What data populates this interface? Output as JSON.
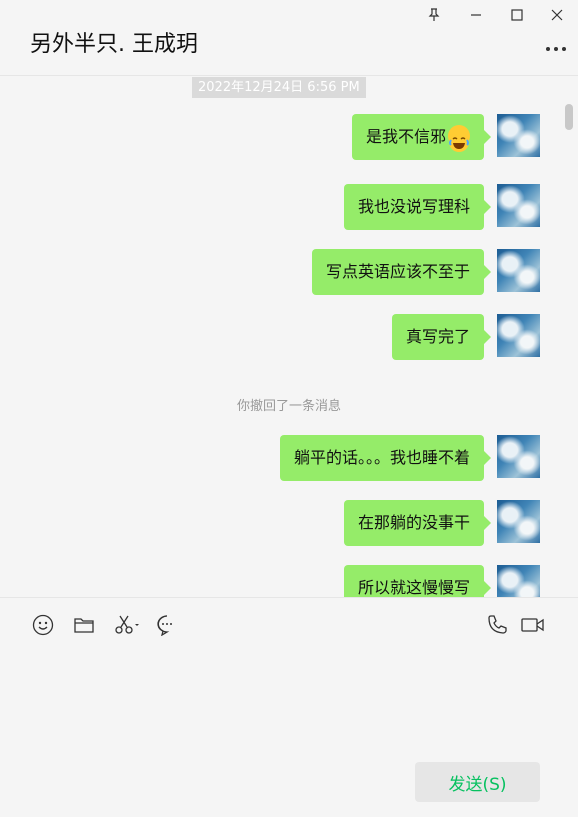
{
  "header": {
    "title": "另外半只. 王成玥"
  },
  "window_controls": [
    "pin-icon",
    "minimize-icon",
    "maximize-icon",
    "close-icon"
  ],
  "chat": {
    "timestamp": "2022年12月24日 6:56 PM",
    "messages": [
      {
        "text": "是我不信邪",
        "emoji": "laughing-tears-emoji"
      },
      {
        "text": "我也没说写理科"
      },
      {
        "text": "写点英语应该不至于"
      },
      {
        "text": "真写完了"
      },
      {
        "text": "躺平的话。。。我也睡不着"
      },
      {
        "text": "在那躺的没事干"
      },
      {
        "text": "所以就这慢慢写"
      }
    ],
    "recall_notice": "你撤回了一条消息"
  },
  "toolbar": {
    "left_icons": [
      "emoji-icon",
      "folder-icon",
      "scissors-icon",
      "chat-history-icon"
    ],
    "right_icons": [
      "phone-icon",
      "video-call-icon"
    ]
  },
  "send_button": {
    "label": "发送(S)"
  },
  "colors": {
    "bubble": "#95ec69",
    "send_text": "#07c160",
    "background": "#f5f5f5"
  }
}
